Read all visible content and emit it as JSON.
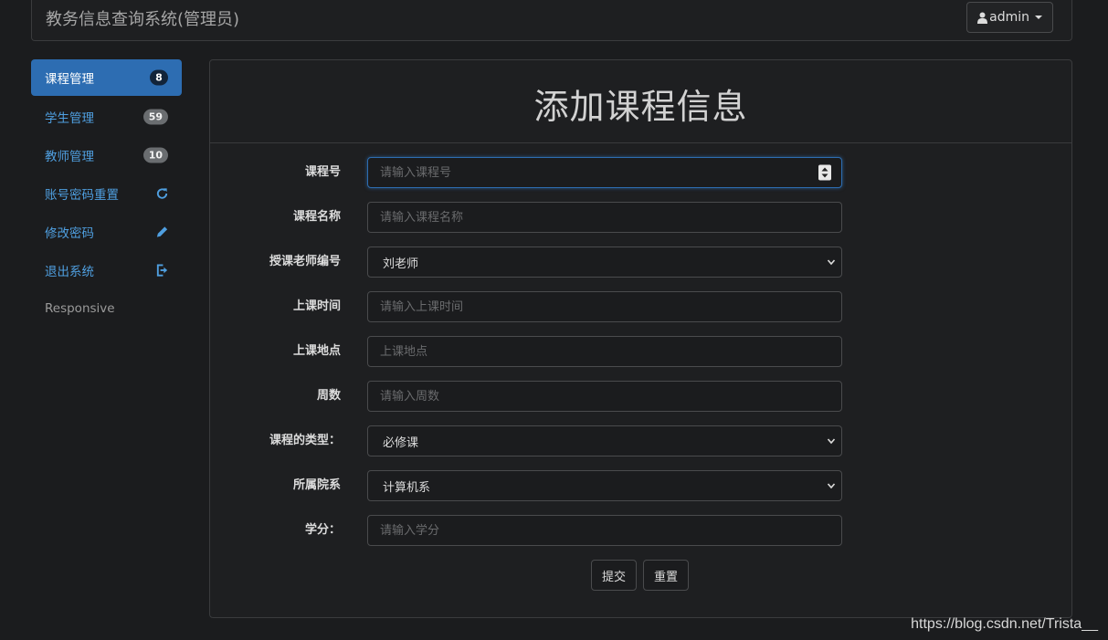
{
  "header": {
    "brand": "教务信息查询系统(管理员)",
    "user_label": "admin"
  },
  "sidebar": {
    "items": [
      {
        "label": "课程管理",
        "badge": "8",
        "active": true
      },
      {
        "label": "学生管理",
        "badge": "59"
      },
      {
        "label": "教师管理",
        "badge": "10"
      },
      {
        "label": "账号密码重置",
        "icon": "refresh-icon"
      },
      {
        "label": "修改密码",
        "icon": "pencil-icon"
      },
      {
        "label": "退出系统",
        "icon": "logout-icon"
      },
      {
        "label": "Responsive"
      }
    ]
  },
  "panel": {
    "title": "添加课程信息"
  },
  "form": {
    "course_id": {
      "label": "课程号",
      "placeholder": "请输入课程号"
    },
    "course_name": {
      "label": "课程名称",
      "placeholder": "请输入课程名称"
    },
    "teacher": {
      "label": "授课老师编号",
      "value": "刘老师"
    },
    "class_time": {
      "label": "上课时间",
      "placeholder": "请输入上课时间"
    },
    "class_place": {
      "label": "上课地点",
      "placeholder": "上课地点"
    },
    "weeks": {
      "label": "周数",
      "placeholder": "请输入周数"
    },
    "course_type": {
      "label": "课程的类型：",
      "value": "必修课"
    },
    "department": {
      "label": "所属院系",
      "value": "计算机系"
    },
    "credit": {
      "label": "学分：",
      "placeholder": "请输入学分"
    },
    "submit_label": "提交",
    "reset_label": "重置"
  },
  "watermark": "https://blog.csdn.net/Trista__",
  "colors": {
    "background": "#1b1c1e",
    "accent": "#2d6db2",
    "link": "#4f9fe0"
  }
}
